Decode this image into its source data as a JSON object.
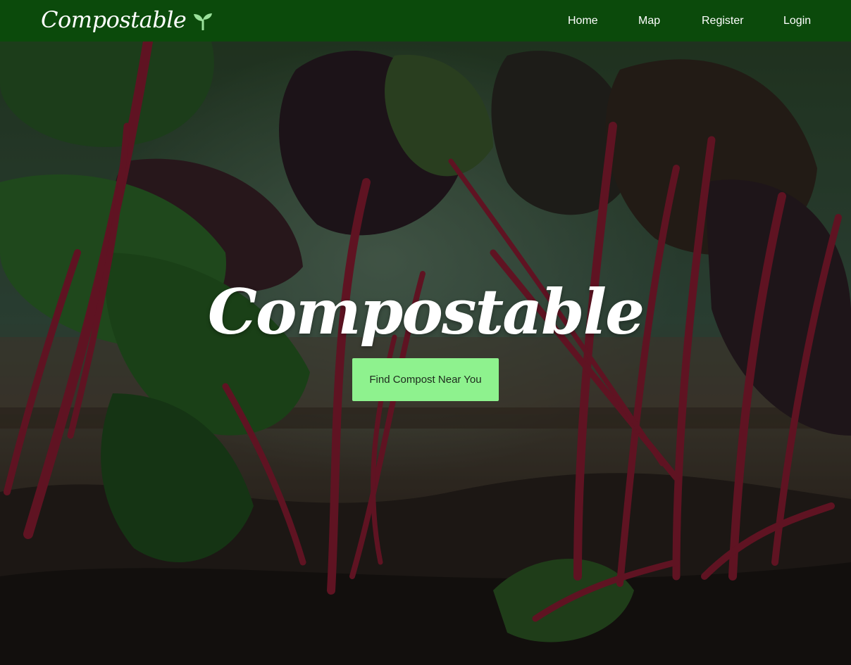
{
  "brand": {
    "name": "Compostable",
    "icon": "sprout-icon"
  },
  "nav": {
    "home": "Home",
    "map": "Map",
    "register": "Register",
    "login": "Login"
  },
  "hero": {
    "title": "Compostable",
    "cta_label": "Find Compost Near You",
    "background": "chard-garden-photo"
  },
  "colors": {
    "navbar": "#0b4a0b",
    "cta_background": "#8ef28e",
    "text_light": "#ffffff"
  }
}
